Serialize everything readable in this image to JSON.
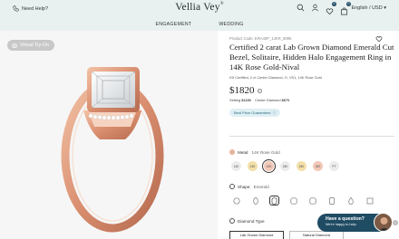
{
  "header": {
    "help_label": "Need Help?",
    "brand": "Vellia Vey",
    "brand_mark": "®",
    "nav": [
      "ENGAGEMENT",
      "WEDDING"
    ],
    "cart_count": "0",
    "wishlist_count": "0",
    "language": "English / USD",
    "language_chevron": "▾"
  },
  "gallery": {
    "try_on_label": "Virtual Try-On"
  },
  "product": {
    "code": "Product Code: ERA40P_14KR_8095",
    "title": "Certified 2 carat Lab Grown Diamond Emerald Cut Bezel, Solitaire, Hidden Halo Engagement Ring in 14K Rose Gold-Nival",
    "subtitle": "IGI Certified, 2 ct Center Diamond, G, VS1, 14K Rose Gold",
    "price": "$1820",
    "price_info": "i",
    "setting_label": "Setting",
    "setting_price": "$1150",
    "center_label": "Center Diamond",
    "center_price": "$670",
    "guarantee": "Best Price Guaranteed",
    "guarantee_info": "ⓘ"
  },
  "options": {
    "metal_label": "Metal:",
    "metal_value": "14K Rose Gold",
    "metals": [
      {
        "label": "14K",
        "color": "#ececec"
      },
      {
        "label": "14K",
        "color": "#f3dfa8"
      },
      {
        "label": "14K",
        "color": "#f2c8b8"
      },
      {
        "label": "18K",
        "color": "#ececec"
      },
      {
        "label": "18K",
        "color": "#f3dfa8"
      },
      {
        "label": "18K",
        "color": "#f2c8b8"
      },
      {
        "label": "PT",
        "color": "#ececec"
      }
    ],
    "selected_metal_index": 2,
    "shape_label": "Shape:",
    "shape_value": "Emerald",
    "shapes": [
      "round-icon",
      "oval-icon",
      "emerald-icon",
      "cushion-icon",
      "asscher-icon",
      "radiant-icon",
      "pear-icon",
      "princess-icon"
    ],
    "selected_shape_index": 2,
    "diamond_type_label": "Diamond Type",
    "diamond_types": [
      "Lab Grown Diamond",
      "Natural Diamond"
    ]
  },
  "chat": {
    "question": "Have a question?",
    "help": "We're happy to help.",
    "close": "×"
  },
  "colors": {
    "header_bg": "#e8f1ef",
    "accent": "#1f4b63",
    "rose_gold": "#e0a184"
  }
}
